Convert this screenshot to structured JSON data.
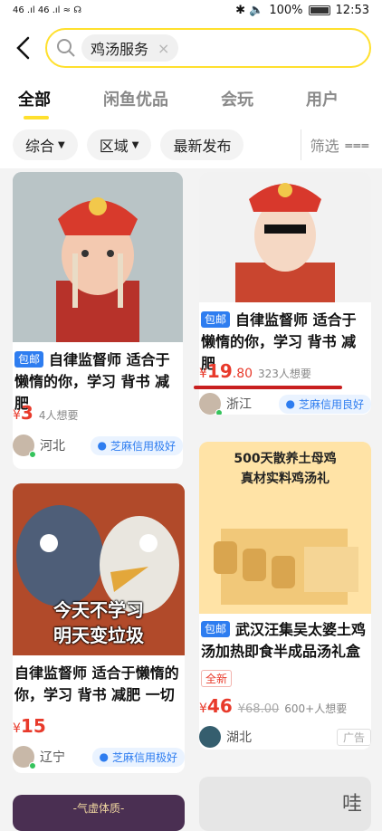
{
  "status_bar": {
    "left_signals": "46 .ıl 46 .ıl ≈ ☊",
    "right_icons": "✱ 🔈",
    "battery_percent": "100%",
    "time": "12:53"
  },
  "search": {
    "query": "鸡汤服务",
    "clear_label": "×",
    "icon": "search-icon"
  },
  "tabs": [
    {
      "label": "全部",
      "active": true
    },
    {
      "label": "闲鱼优品",
      "active": false
    },
    {
      "label": "会玩",
      "active": false
    },
    {
      "label": "用户",
      "active": false
    }
  ],
  "filters": {
    "sort": "综合",
    "region": "区域",
    "latest": "最新发布",
    "screen": "筛选"
  },
  "cards": [
    {
      "tag": "包邮",
      "title": "自律监督师 适合于懒惰的你，学习 背书 减肥",
      "price_symbol": "¥",
      "price": "3",
      "want": "4人想要",
      "location": "河北",
      "credit": "芝麻信用极好"
    },
    {
      "tag": "包邮",
      "title": "自律监督师 适合于懒惰的你，学习 背书 减肥",
      "price_symbol": "¥",
      "price": "19",
      "price_decimal": ".80",
      "want": "323人想要",
      "location": "浙江",
      "credit": "芝麻信用良好"
    },
    {
      "image_caption_1": "今天不学习",
      "image_caption_2": "明天变垃圾",
      "title": "自律监督师 适合于懒惰的你，学习 背书 减肥 一切",
      "price_symbol": "¥",
      "price": "15",
      "location": "辽宁",
      "credit": "芝麻信用极好"
    },
    {
      "image_caption_1": "500天散养土母鸡",
      "image_caption_2": "真材实料鸡汤礼",
      "tag": "包邮",
      "title": "武汉汪集吴太婆土鸡汤加热即食半成品汤礼盒",
      "badge": "全新",
      "price_symbol": "¥",
      "price": "46",
      "old_price": "¥68.00",
      "want": "600+人想要",
      "location": "湖北",
      "ad_label": "广告"
    },
    {
      "image_caption": "-气虚体质-"
    },
    {
      "image_caption": "哇"
    }
  ]
}
